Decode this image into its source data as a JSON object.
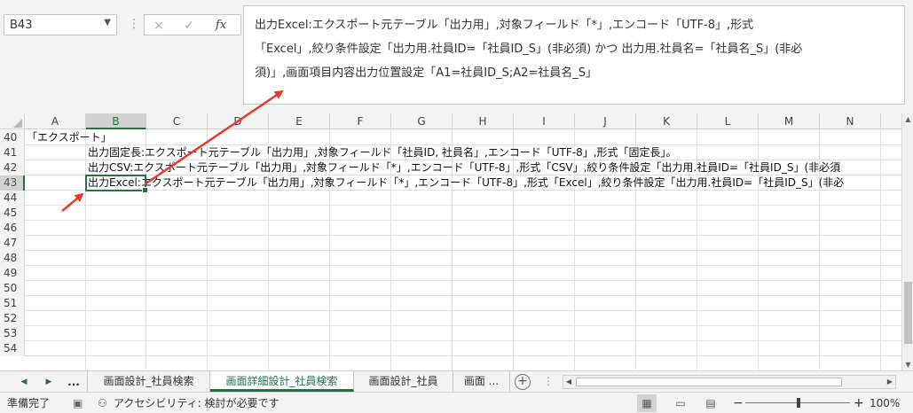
{
  "formula_bar": {
    "name_box": "B43",
    "name_box_dropdown_icon": "chevron-down-icon",
    "cancel_icon": "×",
    "confirm_icon": "✓",
    "fx_label": "fx",
    "formula_lines": [
      "出力Excel:エクスポート元テーブル「出力用」,対象フィールド「*」,エンコード「UTF-8」,形式",
      "「Excel」,絞り条件設定「出力用.社員ID=「社員ID_S」(非必須) かつ 出力用.社員名=「社員名_S」(非必",
      "須)」,画面項目内容出力位置設定「A1=社員ID_S;A2=社員名_S」"
    ]
  },
  "columns": [
    "A",
    "B",
    "C",
    "D",
    "E",
    "F",
    "G",
    "H",
    "I",
    "J",
    "K",
    "L",
    "M",
    "N"
  ],
  "selected_column": "B",
  "rows": [
    {
      "num": "40",
      "text": "「エクスポート」",
      "col": "A"
    },
    {
      "num": "41",
      "text": "出力固定長:エクスポート元テーブル「出力用」,対象フィールド「社員ID, 社員名」,エンコード「UTF-8」,形式「固定長」。",
      "col": "B"
    },
    {
      "num": "42",
      "text": "出力CSV:エクスポート元テーブル「出力用」,対象フィールド「*」,エンコード「UTF-8」,形式「CSV」,絞り条件設定「出力用.社員ID=「社員ID_S」(非必須",
      "col": "B"
    },
    {
      "num": "43",
      "text": "出力Excel:エクスポート元テーブル「出力用」,対象フィールド「*」,エンコード「UTF-8」,形式「Excel」,絞り条件設定「出力用.社員ID=「社員ID_S」(非必",
      "col": "B"
    },
    {
      "num": "44",
      "text": "",
      "col": "A"
    },
    {
      "num": "45",
      "text": "",
      "col": "A"
    },
    {
      "num": "46",
      "text": "",
      "col": "A"
    },
    {
      "num": "47",
      "text": "",
      "col": "A"
    },
    {
      "num": "48",
      "text": "",
      "col": "A"
    },
    {
      "num": "49",
      "text": "",
      "col": "A"
    },
    {
      "num": "50",
      "text": "",
      "col": "A"
    },
    {
      "num": "51",
      "text": "",
      "col": "A"
    },
    {
      "num": "52",
      "text": "",
      "col": "A"
    },
    {
      "num": "53",
      "text": "",
      "col": "A"
    },
    {
      "num": "54",
      "text": "",
      "col": "A"
    }
  ],
  "selected_row": "43",
  "sheet_tabs": [
    {
      "label": "画面設計_社員検索",
      "active": false
    },
    {
      "label": "画面詳細設計_社員検索",
      "active": true
    },
    {
      "label": "画面設計_社員",
      "active": false
    },
    {
      "label": "画面 ...",
      "active": false
    }
  ],
  "tab_nav": {
    "prev": "◀",
    "next": "▶",
    "more": "..."
  },
  "status_bar": {
    "ready": "準備完了",
    "accessibility": "アクセシビリティ: 検討が必要です",
    "zoom": "100%",
    "zoom_minus": "−",
    "zoom_plus": "+"
  },
  "annotation_color": "#e8392c",
  "accent_color": "#217346"
}
